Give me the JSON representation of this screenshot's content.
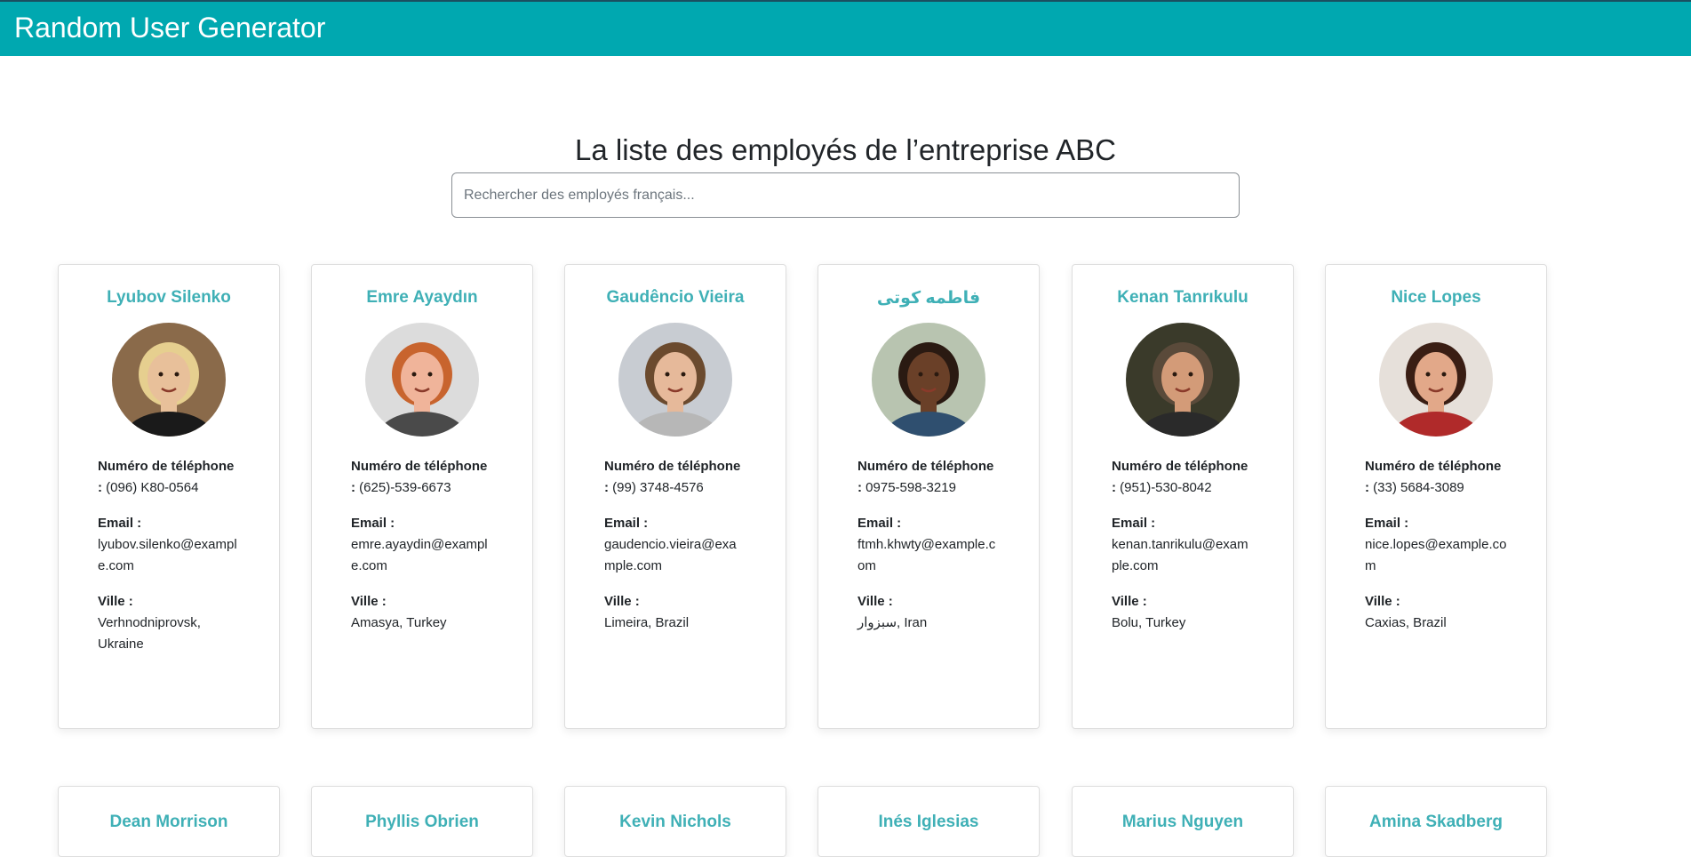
{
  "app": {
    "brand": "Random User Generator"
  },
  "main": {
    "title": "La liste des employés de l’entreprise ABC",
    "search_placeholder": "Rechercher des employés français..."
  },
  "labels": {
    "phone": "Numéro de téléphone :",
    "email": "Email :",
    "city": "Ville :"
  },
  "employees": [
    {
      "name": "Lyubov Silenko",
      "phone": "(096) K80-0564",
      "email": "lyubov.silenko@example.com",
      "city": "Verhnodniprovsk, Ukraine",
      "avatar": {
        "bg": "#8a6a4a",
        "skin": "#e8c09a",
        "hair": "#e6cf8f",
        "shirt": "#1a1a1a"
      }
    },
    {
      "name": "Emre Ayaydın",
      "phone": "(625)-539-6673",
      "email": "emre.ayaydin@example.com",
      "city": "Amasya, Turkey",
      "avatar": {
        "bg": "#dcdcdc",
        "skin": "#f0b49a",
        "hair": "#c8642e",
        "shirt": "#4a4a4a"
      }
    },
    {
      "name": "Gaudêncio Vieira",
      "phone": "(99) 3748-4576",
      "email": "gaudencio.vieira@example.com",
      "city": "Limeira, Brazil",
      "avatar": {
        "bg": "#c8ccd2",
        "skin": "#e6b99a",
        "hair": "#6b4a2e",
        "shirt": "#b7b7b7"
      }
    },
    {
      "name": "فاطمه کوتی",
      "phone": "0975-598-3219",
      "email": "ftmh.khwty@example.com",
      "city": "سبزوار, Iran",
      "avatar": {
        "bg": "#b8c4b0",
        "skin": "#6a4028",
        "hair": "#2a1a12",
        "shirt": "#2f4f6f"
      }
    },
    {
      "name": "Kenan Tanrıkulu",
      "phone": "(951)-530-8042",
      "email": "kenan.tanrikulu@example.com",
      "city": "Bolu, Turkey",
      "avatar": {
        "bg": "#3a3a2a",
        "skin": "#d39b78",
        "hair": "#5a4a3a",
        "shirt": "#2a2a2a"
      }
    },
    {
      "name": "Nice Lopes",
      "phone": "(33) 5684-3089",
      "email": "nice.lopes@example.com",
      "city": "Caxias, Brazil",
      "avatar": {
        "bg": "#e6e0da",
        "skin": "#e2a889",
        "hair": "#3a1e14",
        "shirt": "#b02a2a"
      }
    },
    {
      "name": "Dean Morrison"
    },
    {
      "name": "Phyllis Obrien"
    },
    {
      "name": "Kevin Nichols"
    },
    {
      "name": "Inés Iglesias"
    },
    {
      "name": "Marius Nguyen"
    },
    {
      "name": "Amina Skadberg"
    }
  ],
  "colors": {
    "navbar": "#00a8b0",
    "accent": "#3fb0b6"
  }
}
